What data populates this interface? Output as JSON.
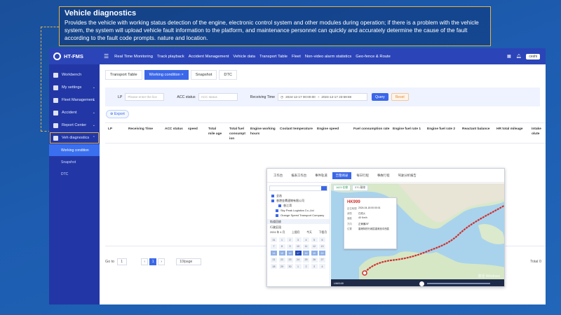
{
  "callout": {
    "title": "Vehicle diagnostics",
    "body": "Provides the vehicle with working status detection of the engine, electronic control system and other modules during operation; if there is a problem with the vehicle system, the system will upload vehicle fault information to the platform, and maintenance personnel can quickly and accurately determine the cause of the fault according to the fault code prompts. nature and location."
  },
  "topbar": {
    "logo": "HT-FMS",
    "nav": [
      "Real Time Monitoring",
      "Track playback",
      "Accident Management",
      "Vehicle data",
      "Transport Table",
      "Fleet",
      "Non-video alarm statistics",
      "Geo-fence & Route"
    ],
    "user": "ceshi"
  },
  "sidebar": {
    "items": [
      {
        "label": "Workbench"
      },
      {
        "label": "My settings"
      },
      {
        "label": "Fleet Management"
      },
      {
        "label": "Accident"
      },
      {
        "label": "Report Center"
      },
      {
        "label": "Veh diagnostics"
      }
    ],
    "subitems": [
      "Working condition",
      "Snapshot",
      "DTC"
    ]
  },
  "tabs": [
    {
      "label": "Transport Table"
    },
    {
      "label": "Working condition",
      "close": "×"
    },
    {
      "label": "Snapshot"
    },
    {
      "label": "DTC"
    }
  ],
  "filter": {
    "lp_label": "LP",
    "lp_placeholder": "Please enter the lice",
    "acc_label": "ACC status",
    "acc_placeholder": "ACC status",
    "time_label": "Receiving Time",
    "time_start": "2024-12-17 00:00:00",
    "time_sep": "~",
    "time_end": "2024-12-17 23:59:59",
    "query": "Query",
    "reset": "Reset"
  },
  "export_label": "Export",
  "columns": [
    "LP",
    "Receiving Time",
    "ACC status",
    "speed",
    "Total mile age",
    "Total fuel consumpt ion",
    "Engine working hours",
    "Coolant temperature",
    "Engine speed",
    "Fuel consumption rate",
    "Engine fuel rate 1",
    "Engine fuel rate 2",
    "Reactant balance",
    "HR total mileage",
    "Intake olute"
  ],
  "pager": {
    "goto": "Go to",
    "goto_value": "1",
    "prev": "‹",
    "page": "1",
    "next": "›",
    "size": "10/page",
    "total": "Total 0"
  },
  "mapwin": {
    "tabs": [
      "工作台",
      "报表工作台",
      "事件轨道",
      "告警阅录",
      "每日行程",
      "事故行程",
      "驾驶分析报告"
    ],
    "active_tab_index": 3,
    "tree": [
      "全选",
      "香港金鹰速物有限公司",
      "香江湾",
      "Sky Peak Logistics Co.,Ltd",
      "Orange Speed Transport Company"
    ],
    "section1": "轨道回放",
    "section2": "行驶区段",
    "cal_month": "2024 年 4 月",
    "cal_nav": [
      "上個月",
      "今天",
      "下個月"
    ],
    "cal_days": [
      "31",
      "1",
      "2",
      "3",
      "4",
      "5",
      "6",
      "7",
      "8",
      "9",
      "10",
      "11",
      "12",
      "13",
      "14",
      "15",
      "16",
      "17",
      "18",
      "19",
      "20",
      "21",
      "22",
      "23",
      "24",
      "25",
      "26",
      "27",
      "28",
      "29",
      "30",
      "1",
      "2",
      "3",
      "4"
    ],
    "cal_selected": "17",
    "stats": [
      "1623 在線",
      "570 離線"
    ],
    "popup": {
      "plate": "HK999",
      "rows": [
        {
          "k": "定位時間",
          "v": "2024-04-18 00:00:01"
        },
        {
          "k": "狀態",
          "v": "已熄火"
        },
        {
          "k": "速度",
          "v": "40 Km/h"
        },
        {
          "k": "方向",
          "v": "正東偏28°"
        },
        {
          "k": "位置",
          "v": "香港特別行政區香港島中西區"
        }
      ]
    },
    "player_plate": "UA6148",
    "watermark": "激活 Windows"
  },
  "colors": {
    "primary": "#2b44b8",
    "accent": "#3b67e8",
    "callout_border": "#e3b24a",
    "route": "#d0302e"
  }
}
